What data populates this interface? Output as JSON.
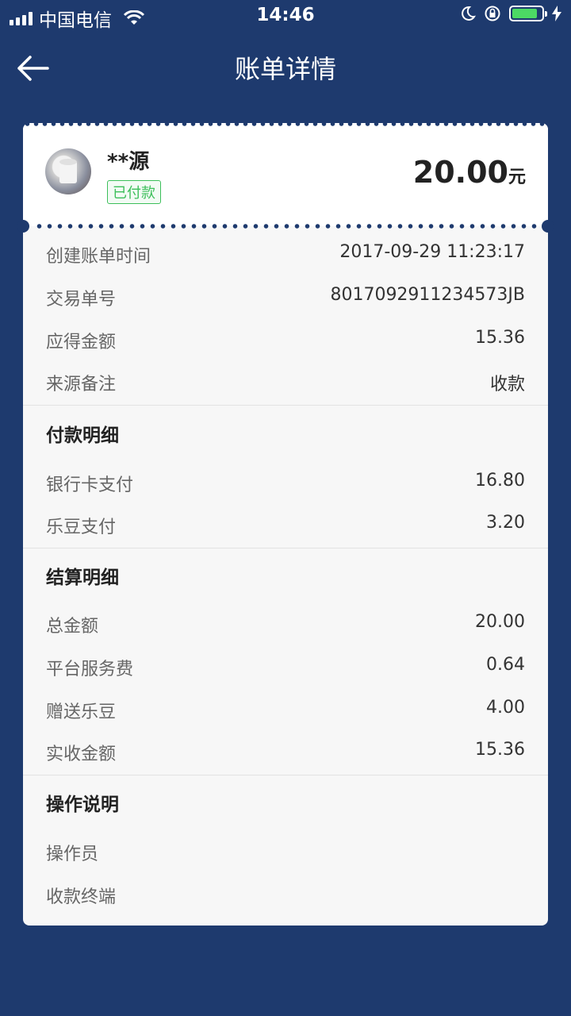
{
  "status_bar": {
    "carrier": "中国电信",
    "time": "14:46",
    "battery_level": 0.85,
    "icons": [
      "signal-icon",
      "wifi-icon",
      "moon-icon",
      "rotation-lock-icon",
      "battery-icon",
      "charging-icon"
    ]
  },
  "nav": {
    "title": "账单详情",
    "back_icon": "arrow-left-icon"
  },
  "header": {
    "user_name": "**源",
    "status_badge": "已付款",
    "amount": "20.00",
    "amount_unit": "元"
  },
  "bill_info": [
    {
      "label": "创建账单时间",
      "value": "2017-09-29 11:23:17"
    },
    {
      "label": "交易单号",
      "value": "8017092911234573JB"
    },
    {
      "label": "应得金额",
      "value": "15.36"
    },
    {
      "label": "来源备注",
      "value": "收款"
    }
  ],
  "payment_detail": {
    "title": "付款明细",
    "rows": [
      {
        "label": "银行卡支付",
        "value": "16.80"
      },
      {
        "label": "乐豆支付",
        "value": "3.20"
      }
    ]
  },
  "settlement_detail": {
    "title": "结算明细",
    "rows": [
      {
        "label": "总金额",
        "value": "20.00"
      },
      {
        "label": "平台服务费",
        "value": "0.64"
      },
      {
        "label": "赠送乐豆",
        "value": "4.00"
      },
      {
        "label": "实收金额",
        "value": "15.36"
      }
    ]
  },
  "operation_detail": {
    "title": "操作说明",
    "rows": [
      {
        "label": "操作员",
        "value": ""
      },
      {
        "label": "收款终端",
        "value": ""
      }
    ]
  },
  "colors": {
    "background": "#1e3a6e",
    "card": "#f7f7f7",
    "badge_green": "#3cbf5a",
    "battery_green": "#4cd964"
  }
}
